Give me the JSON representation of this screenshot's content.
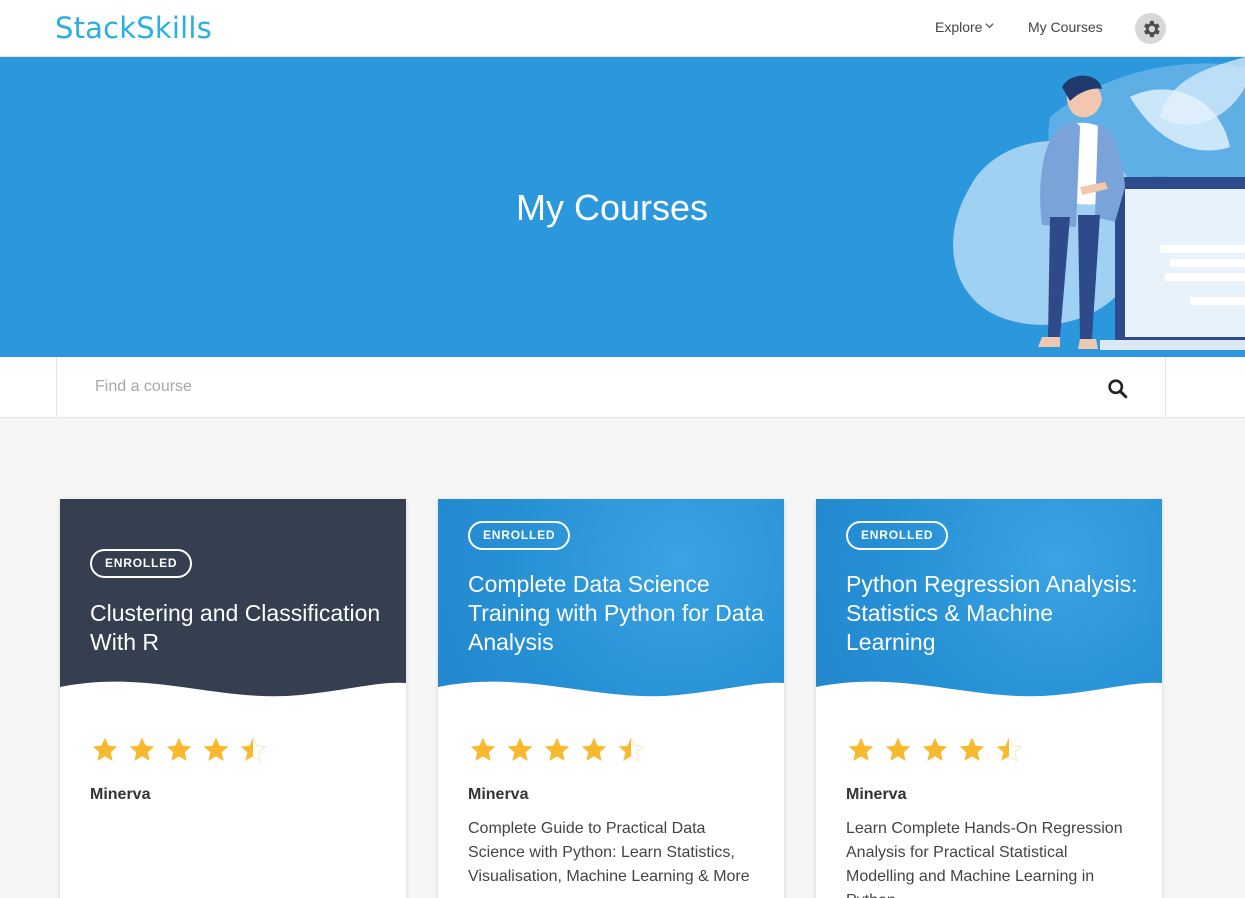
{
  "header": {
    "logo": "StackSkills",
    "nav": {
      "explore": "Explore",
      "my_courses": "My Courses"
    }
  },
  "hero": {
    "title": "My Courses"
  },
  "search": {
    "placeholder": "Find a course"
  },
  "courses": [
    {
      "badge": "ENROLLED",
      "title": "Clustering and Classification With R",
      "rating": 4.5,
      "author": "Minerva",
      "description": ""
    },
    {
      "badge": "ENROLLED",
      "title": "Complete Data Science Training with Python for Data Analysis",
      "rating": 4.5,
      "author": "Minerva",
      "description": "Complete Guide to Practical Data Science with Python: Learn Statistics, Visualisation, Machine Learning & More"
    },
    {
      "badge": "ENROLLED",
      "title": "Python Regression Analysis: Statistics & Machine Learning",
      "rating": 4.5,
      "author": "Minerva",
      "description": "Learn Complete Hands-On Regression Analysis for Practical Statistical Modelling and Machine Learning in Python"
    }
  ],
  "colors": {
    "brand": "#2aaee3",
    "hero_bg": "#2b97dc",
    "card_dark": "#353f4f",
    "star": "#f7b92e"
  }
}
